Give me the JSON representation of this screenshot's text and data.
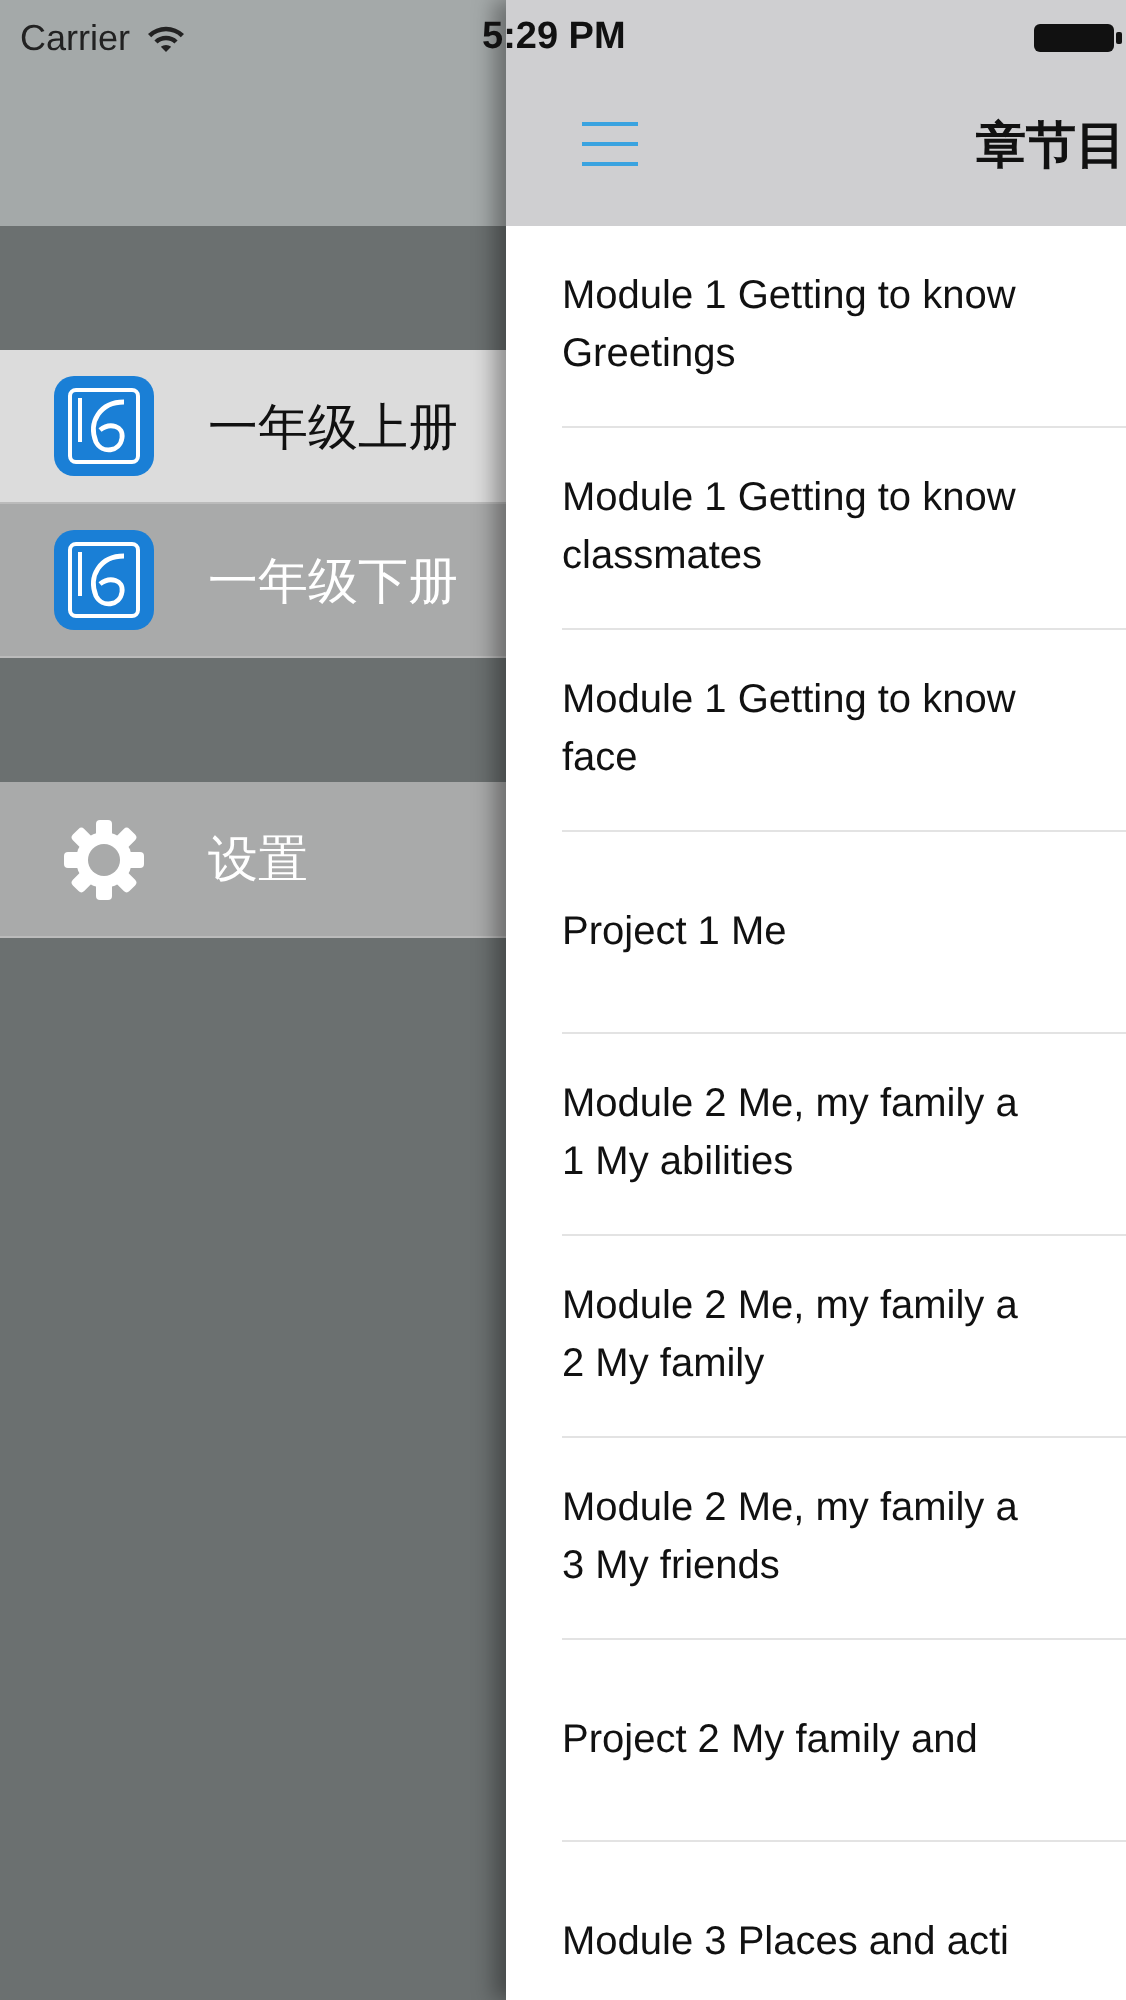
{
  "status_bar": {
    "carrier": "Carrier",
    "time": "5:29 PM"
  },
  "sidebar": {
    "books": [
      {
        "label": "一年级上册",
        "selected": true
      },
      {
        "label": "一年级下册",
        "selected": false
      }
    ],
    "settings": {
      "label": "设置"
    }
  },
  "nav_bar": {
    "title": "章节目"
  },
  "chapters": [
    {
      "lines": [
        "Module 1 Getting to know",
        "Greetings"
      ]
    },
    {
      "lines": [
        "Module 1 Getting to know",
        "classmates"
      ]
    },
    {
      "lines": [
        "Module 1 Getting to know",
        "face"
      ]
    },
    {
      "lines": [
        "Project 1 Me"
      ]
    },
    {
      "lines": [
        "Module 2 Me, my family a",
        "1 My abilities"
      ]
    },
    {
      "lines": [
        "Module 2 Me, my family a",
        "2 My family"
      ]
    },
    {
      "lines": [
        "Module 2 Me, my family a",
        "3 My friends"
      ]
    },
    {
      "lines": [
        "Project 2 My family and"
      ]
    },
    {
      "lines": [
        "Module 3 Places and acti"
      ]
    }
  ]
}
